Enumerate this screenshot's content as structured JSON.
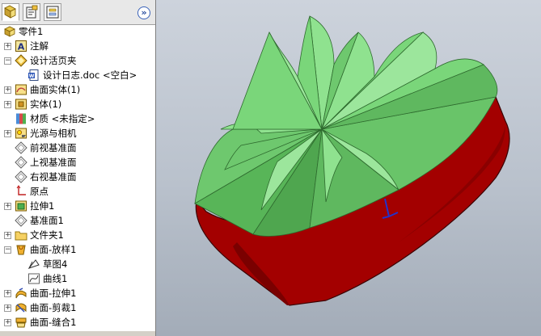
{
  "feature_tree": {
    "tabs": [
      "feature-manager",
      "property-manager",
      "configuration-manager"
    ],
    "expand_icon": "double-chevron-right",
    "items": [
      {
        "label": "零件1",
        "icon": "part-icon",
        "toggle": ""
      },
      {
        "label": "注解",
        "icon": "annotation-icon",
        "toggle": "+"
      },
      {
        "label": "设计活页夹",
        "icon": "design-binder-icon",
        "toggle": "−"
      },
      {
        "label": "设计日志.doc <空白>",
        "icon": "doc-icon",
        "toggle": ""
      },
      {
        "label": "曲面实体(1)",
        "icon": "surface-body-icon",
        "toggle": "+"
      },
      {
        "label": "实体(1)",
        "icon": "solid-body-icon",
        "toggle": "+"
      },
      {
        "label": "材质 <未指定>",
        "icon": "material-icon",
        "toggle": ""
      },
      {
        "label": "光源与相机",
        "icon": "lights-camera-icon",
        "toggle": "+"
      },
      {
        "label": "前视基准面",
        "icon": "plane-icon",
        "toggle": ""
      },
      {
        "label": "上视基准面",
        "icon": "plane-icon",
        "toggle": ""
      },
      {
        "label": "右视基准面",
        "icon": "plane-icon",
        "toggle": ""
      },
      {
        "label": "原点",
        "icon": "origin-icon",
        "toggle": ""
      },
      {
        "label": "拉伸1",
        "icon": "extrude-icon",
        "toggle": "+"
      },
      {
        "label": "基准面1",
        "icon": "plane-icon",
        "toggle": ""
      },
      {
        "label": "文件夹1",
        "icon": "folder-icon",
        "toggle": "+"
      },
      {
        "label": "曲面-放样1",
        "icon": "surface-loft-icon",
        "toggle": "−"
      },
      {
        "label": "草图4",
        "icon": "sketch-icon",
        "toggle": ""
      },
      {
        "label": "曲线1",
        "icon": "curve-icon",
        "toggle": ""
      },
      {
        "label": "曲面-拉伸1",
        "icon": "surface-extrude-icon",
        "toggle": "+"
      },
      {
        "label": "曲面-剪裁1",
        "icon": "surface-trim-icon",
        "toggle": "+"
      },
      {
        "label": "曲面-缝合1",
        "icon": "surface-knit-icon",
        "toggle": "+"
      }
    ]
  },
  "viewport": {
    "model": "crown-gear-3d-model",
    "colors": {
      "teeth": "#7edb7e",
      "body": "#a30000",
      "axis": "#2233cc"
    }
  }
}
